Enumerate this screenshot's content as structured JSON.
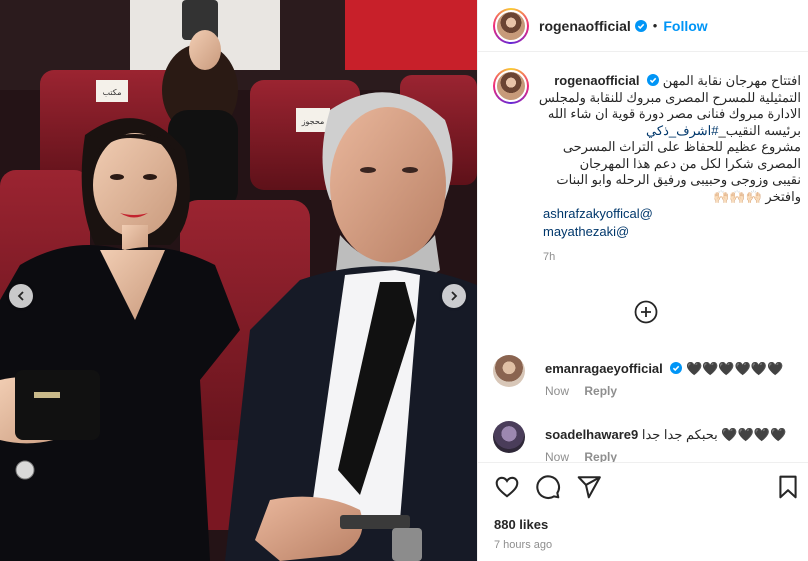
{
  "post": {
    "author": "rogenaofficial",
    "follow_label": "Follow",
    "separator": "•",
    "caption_lines": [
      "افتتاح مهرجان نقابة المهن",
      "التمثيلية للمسرح المصرى مبروك للنقابة ولمجلس",
      "الادارة مبروك فنانى مصر دورة قوية ان شاء الله",
      "برئيسه النقيب_",
      "مشروع عظيم للحفاظ على التراث المسرحى",
      "المصرى شكرا لكل من دعم هذا المهرجان",
      "نقيبى وزوجى وحبيبى ورفيق الرحله وابو البنات",
      "وافتخر 🙌🏻🙌🏻🙌🏻"
    ],
    "hashtag": "#اشرف_ذكي",
    "mentions": [
      "ashrafzakyoffical@",
      "mayathezaki@"
    ],
    "caption_time": "7h"
  },
  "comments": [
    {
      "user": "emanragaeyofficial",
      "text": "🖤🖤🖤🖤🖤🖤",
      "time": "Now",
      "reply_label": "Reply",
      "verified": true
    },
    {
      "user": "soadelhaware9",
      "text": "بحبكم جدا جدا 🖤🖤🖤🖤",
      "time": "Now",
      "reply_label": "Reply",
      "verified": false
    }
  ],
  "actions": {
    "likes": "880 likes",
    "posted": "7 hours ago"
  },
  "photo": {
    "seat_labels": [
      "مكتب",
      "محجوز",
      "محجوز"
    ]
  },
  "colors": {
    "accent": "#0095f6",
    "link": "#00376b",
    "muted": "#8e8e8e",
    "seat": "#8a1e2a"
  }
}
